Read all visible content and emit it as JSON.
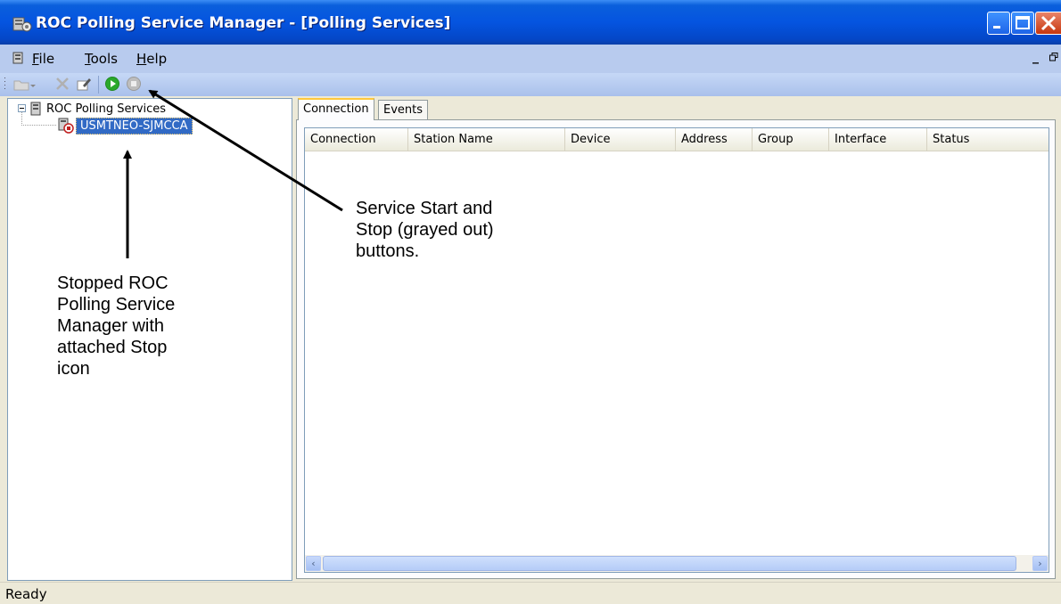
{
  "window": {
    "title": "ROC Polling Service Manager - [Polling Services]"
  },
  "menu": {
    "items": [
      {
        "accel": "F",
        "rest": "ile"
      },
      {
        "accel": "T",
        "rest": "ools"
      },
      {
        "accel": "H",
        "rest": "elp"
      }
    ]
  },
  "toolbar": {
    "icons": [
      "new-icon",
      "delete-icon",
      "edit-icon",
      "start-service-icon",
      "stop-service-icon"
    ]
  },
  "tree": {
    "root_label": "ROC Polling Services",
    "child_label": "USMTNEO-SJMCCA"
  },
  "tabs": [
    "Connection",
    "Events"
  ],
  "list": {
    "columns": [
      "Connection",
      "Station Name",
      "Device",
      "Address",
      "Group",
      "Interface",
      "Status"
    ]
  },
  "status": {
    "text": "Ready"
  },
  "annotations": {
    "service_buttons": [
      "Service Start and",
      "Stop (grayed out)",
      "buttons."
    ],
    "stopped_manager": [
      "Stopped ROC",
      "Polling Service",
      "Manager with",
      "attached Stop",
      "icon"
    ]
  },
  "colors": {
    "titlebar": "#0554e0",
    "selection": "#316ac5",
    "start_icon": "#1f8a1f",
    "stop_icon_disabled": "#9a9a9a"
  }
}
